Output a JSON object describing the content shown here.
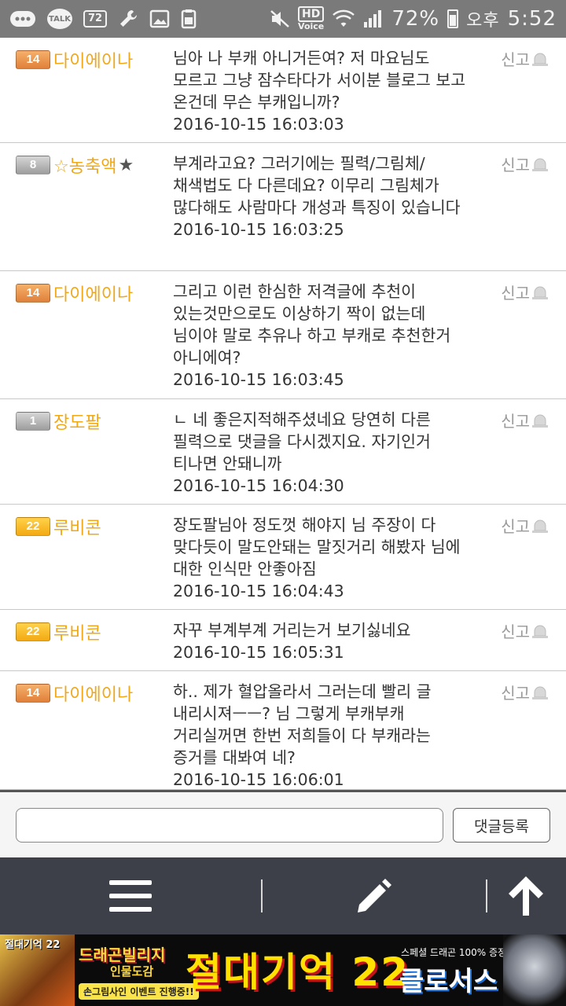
{
  "status_bar": {
    "talk_icon_text": "TALK",
    "notification_count": "72",
    "hd_top": "HD",
    "hd_bottom": "Voice",
    "battery": "72%",
    "ampm": "오후",
    "time": "5:52"
  },
  "comments": [
    {
      "level": "14",
      "level_color": "orange",
      "nickname": "다이에이나",
      "star": false,
      "text": "님아 나 부캐 아니거든여? 저 마요님도 모르고 그냥 잠수타다가 서이분 블로그 보고 온건데 무슨 부캐입니까?",
      "timestamp": "2016-10-15 16:03:03",
      "report": "신고"
    },
    {
      "level": "8",
      "level_color": "gray",
      "nickname": "☆농축액",
      "star": true,
      "text": "부계라고요? 그러기에는 필력/그림체/채색법도 다 다른데요? 이무리 그림체가 많다해도 사람마다 개성과 특징이 있습니다",
      "timestamp": "2016-10-15 16:03:25",
      "report": "신고"
    },
    {
      "level": "14",
      "level_color": "orange",
      "nickname": "다이에이나",
      "star": false,
      "text": "그리고 이런 한심한 저격글에 추천이 있는것만으로도 이상하기 짝이 없는데 님이야 말로 추유나 하고 부캐로 추천한거 아니에여?",
      "timestamp": "2016-10-15 16:03:45",
      "report": "신고"
    },
    {
      "level": "1",
      "level_color": "gray",
      "nickname": "장도팔",
      "star": false,
      "text": "ㄴ 네 좋은지적해주셨네요 당연히 다른 필력으로 댓글을 다시겠지요. 자기인거 티나면 안돼니까",
      "timestamp": "2016-10-15 16:04:30",
      "report": "신고"
    },
    {
      "level": "22",
      "level_color": "yellow",
      "nickname": "루비콘",
      "star": false,
      "text": "장도팔님아 정도껏 해야지 님 주장이 다 맞다듯이 말도안돼는 말짓거리 해봤자 님에 대한 인식만 안좋아짐",
      "timestamp": "2016-10-15 16:04:43",
      "report": "신고"
    },
    {
      "level": "22",
      "level_color": "yellow",
      "nickname": "루비콘",
      "star": false,
      "text": "자꾸 부계부계 거리는거 보기싫네요",
      "timestamp": "2016-10-15 16:05:31",
      "report": "신고"
    },
    {
      "level": "14",
      "level_color": "orange",
      "nickname": "다이에이나",
      "star": false,
      "text": "하.. 제가 혈압올라서 그러는데 빨리 글 내리시져ㅡㅡ? 님 그렇게 부캐부캐 거리실꺼면 한번 저희들이 다 부캐라는 증거를 대봐여 네?",
      "timestamp": "2016-10-15 16:06:01",
      "report": "신고"
    }
  ],
  "comment_form": {
    "input_value": "",
    "submit_label": "댓글등록"
  },
  "toolbar": {
    "menu_icon": "hamburger-menu-icon",
    "write_icon": "pencil-icon",
    "top_icon": "arrow-up-icon"
  },
  "ad": {
    "left_cover_text": "절대기억 22",
    "logo": "드래곤빌리지",
    "logo_sub": "인물도감",
    "event": "손그림사인 이벤트 진행중!!",
    "title": "절대기억 22",
    "promo": "스페셜 드래곤 100% 증정",
    "product": "클로서스"
  },
  "colors": {
    "nickname": "#f0a818",
    "toolbar_bg": "#3d4049",
    "status_bar_bg": "#7a7a7a"
  }
}
